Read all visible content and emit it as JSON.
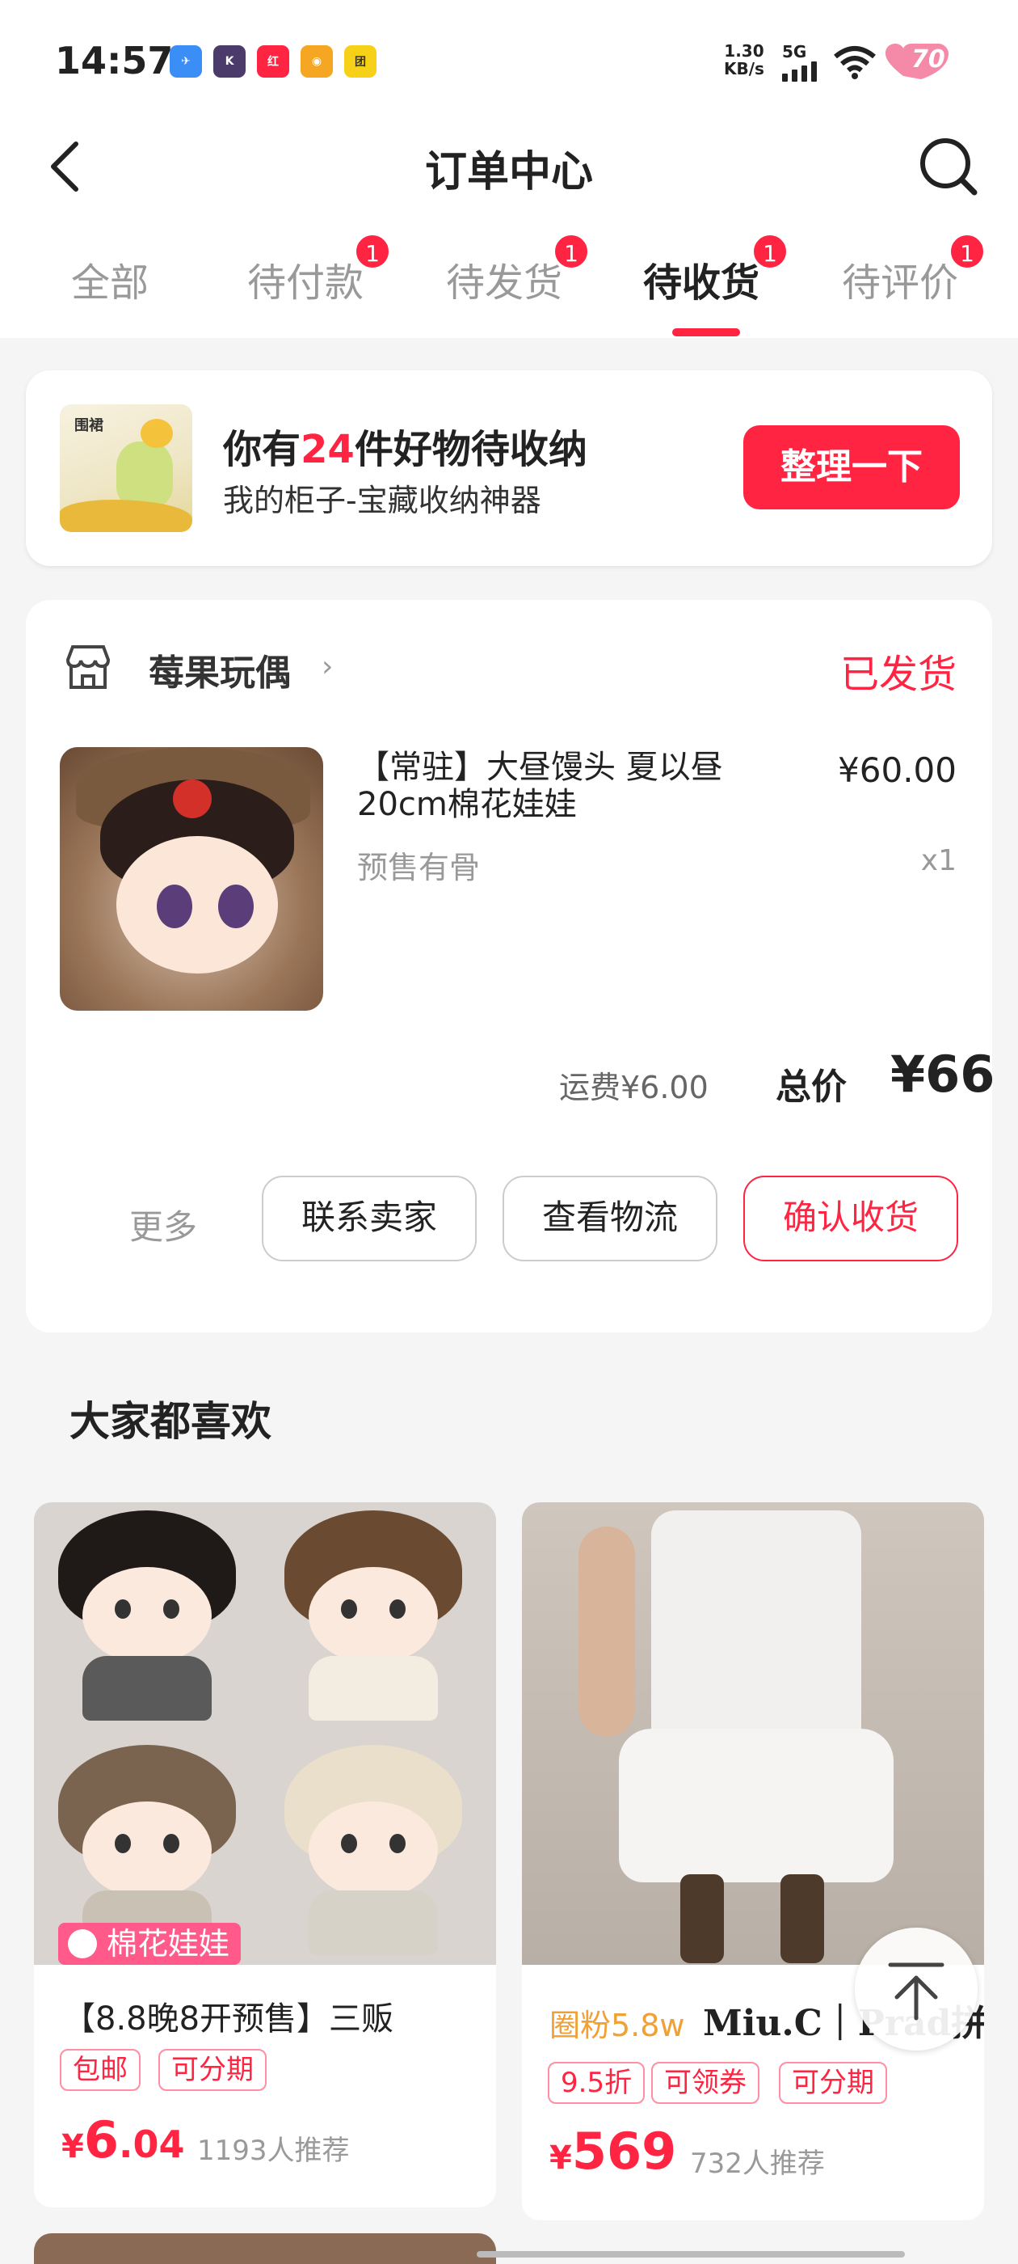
{
  "status_bar": {
    "time": "14:57",
    "net_speed_value": "1.30",
    "net_speed_unit": "KB/s",
    "network": "5G",
    "battery": "70"
  },
  "header": {
    "title": "订单中心"
  },
  "tabs": [
    {
      "label": "全部"
    },
    {
      "label": "待付款",
      "badge": "1"
    },
    {
      "label": "待发货",
      "badge": "1"
    },
    {
      "label": "待收货",
      "badge": "1"
    },
    {
      "label": "待评价",
      "badge": "1"
    }
  ],
  "banner": {
    "text_prefix": "你有",
    "count": "24",
    "text_suffix": "件好物待收纳",
    "subtitle": "我的柜子-宝藏收纳神器",
    "thumb_label": "围裙",
    "button": "整理一下"
  },
  "order": {
    "shop_name": "莓果玩偶",
    "status": "已发货",
    "product_name": "【常驻】大昼馒头 夏以昼20cm棉花娃娃",
    "spec": "预售有骨",
    "price": "¥60.00",
    "qty": "x1",
    "shipping": "运费¥6.00",
    "total_label": "总价",
    "total_value": "¥66",
    "more": "更多",
    "buttons": [
      "联系卖家",
      "查看物流",
      "确认收货"
    ]
  },
  "recommend": {
    "title": "大家都喜欢",
    "items": [
      {
        "category_tag": "棉花娃娃",
        "name": "【8.8晚8开预售】三贩",
        "chips": [
          "包邮",
          "可分期"
        ],
        "price_yen": "¥",
        "price_int": "6",
        "price_dec": ".04",
        "recommend_count": "1193人推荐"
      },
      {
        "fans": "圈粉5.8w",
        "brand": "Miu.C｜Prad拼",
        "chips": [
          "9.5折",
          "可领券",
          "可分期"
        ],
        "price_yen": "¥",
        "price_int": "569",
        "recommend_count": "732人推荐"
      }
    ]
  },
  "colors": {
    "accent": "#ff2442",
    "orange": "#f0a034"
  }
}
